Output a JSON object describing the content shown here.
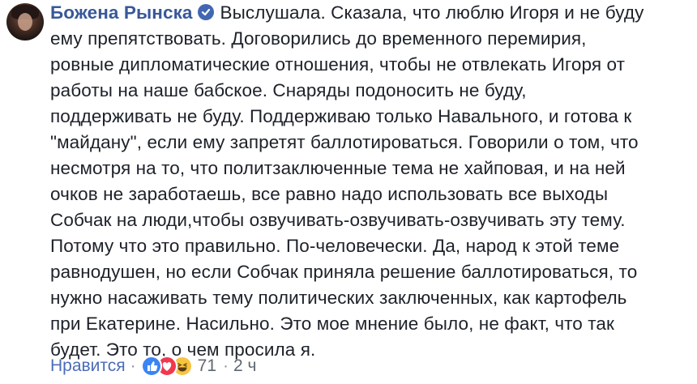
{
  "comment": {
    "author": "Божена Рынска",
    "verified": true,
    "lines": [
      "Выслушала. Сказала, что люблю Игоря и не буду",
      "ему препятствовать. Договорились до временного перемирия,",
      "ровные дипломатические отношения, чтобы не отвлекать Игоря от",
      "работы на наше бабское. Снаряды подоносить не буду,",
      "поддерживать не буду. Поддерживаю только Навального, и готова к",
      "\"майдану\", если ему запретят баллотироваться. Говорили о том, что",
      "несмотря на то, что политзаключенные тема не хайповая, и на ней",
      "очков не заработаешь, все равно надо использовать все выходы",
      "Собчак на люди,чтобы озвучивать-озвучивать-озвучивать эту тему.",
      "Потому что это правильно. По-человечески. Да, народ к этой теме",
      "равнодушен, но если Собчак приняла решение баллотироваться, то",
      "нужно насаживать тему политических заключенных, как картофель",
      "при Екатерине. Насильно. Это мое мнение было, не факт, что так",
      "будет. Это то, о чем просила я."
    ]
  },
  "actions": {
    "like_label": "Нравится",
    "separator": "·",
    "reaction_icons": [
      "like-icon",
      "love-icon",
      "haha-icon"
    ],
    "reaction_count": "71",
    "timestamp": "2 ч"
  },
  "colors": {
    "author": "#385898",
    "text": "#1d2129",
    "meta": "#606770",
    "like_link": "#4b6cb7"
  }
}
